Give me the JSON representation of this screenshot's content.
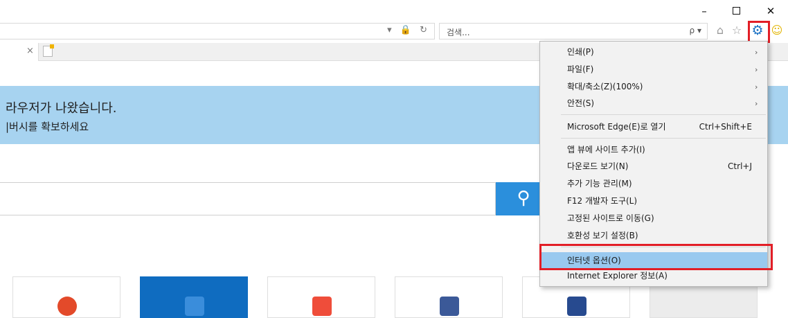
{
  "window": {
    "minimize_glyph": "–",
    "close_glyph": "✕"
  },
  "toolbar": {
    "search_placeholder": "검색...",
    "search_icons": "ρ ▾",
    "address_icons": "▾ 🔒 ↻"
  },
  "tab": {
    "close_glyph": "×"
  },
  "banner": {
    "line1": "라우저가 나왔습니다.",
    "line2": "|버시를 확보하세요"
  },
  "page": {
    "search_button_glyph": "⚲"
  },
  "menu": {
    "items": [
      {
        "label": "인쇄(P)",
        "arrow": "›"
      },
      {
        "label": "파일(F)",
        "arrow": "›"
      },
      {
        "label": "확대/축소(Z)(100%)",
        "arrow": "›"
      },
      {
        "label": "안전(S)",
        "arrow": "›"
      },
      {
        "label": "Microsoft Edge(E)로 열기",
        "shortcut": "Ctrl+Shift+E"
      },
      {
        "label": "앱 뷰에 사이트 추가(I)"
      },
      {
        "label": "다운로드 보기(N)",
        "shortcut": "Ctrl+J"
      },
      {
        "label": "추가 기능 관리(M)"
      },
      {
        "label": "F12 개발자 도구(L)"
      },
      {
        "label": "고정된 사이트로 이동(G)"
      },
      {
        "label": "호환성 보기 설정(B)"
      },
      {
        "label": "인터넷 옵션(O)"
      },
      {
        "label": "Internet Explorer 정보(A)"
      }
    ]
  },
  "colors": {
    "highlight_border": "#e21e26",
    "menu_selected": "#99c9ef",
    "banner": "#a7d3f0",
    "accent": "#2b8fdc"
  }
}
